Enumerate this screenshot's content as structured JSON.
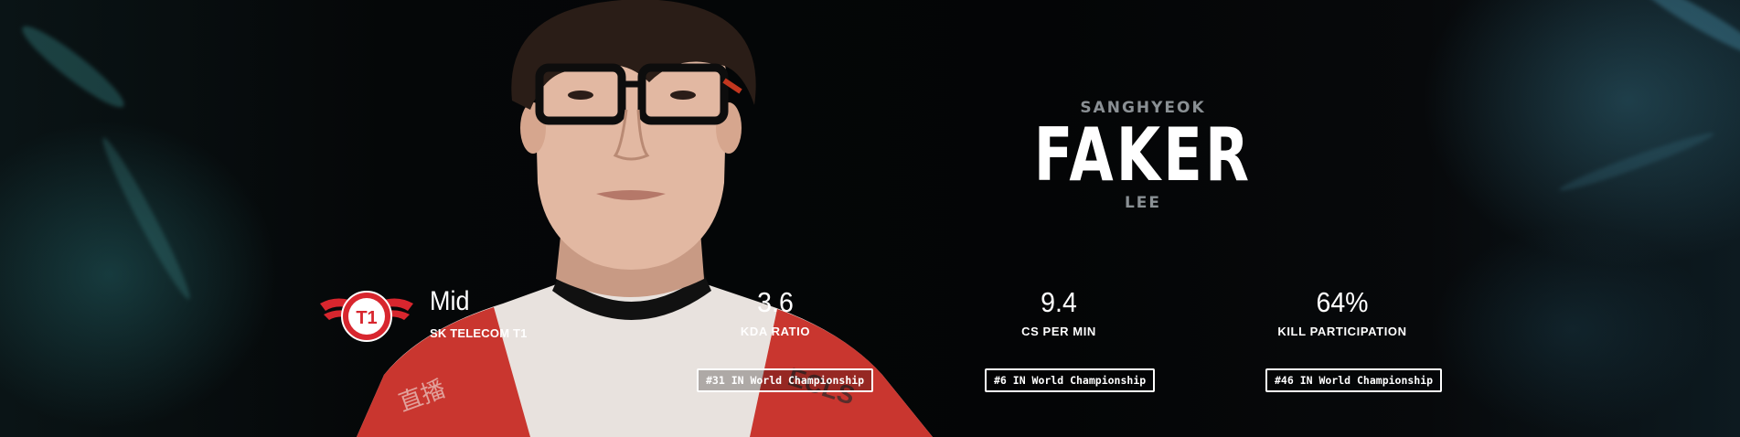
{
  "player": {
    "first_name": "SANGHYEOK",
    "handle": "FAKER",
    "last_name": "LEE"
  },
  "team": {
    "role": "Mid",
    "name": "SK TELECOM T1",
    "logo_icon": "skt-t1-logo"
  },
  "stats": [
    {
      "value": "3.6",
      "label": "KDA RATIO",
      "rank": "#31 IN World Championship"
    },
    {
      "value": "9.4",
      "label": "CS PER MIN",
      "rank": "#6 IN World Championship"
    },
    {
      "value": "64%",
      "label": "KILL PARTICIPATION",
      "rank": "#46 IN World Championship"
    }
  ],
  "colors": {
    "background": "#050607",
    "muted_text": "#8a9094",
    "accent_red": "#d8262e",
    "text": "#ffffff"
  }
}
